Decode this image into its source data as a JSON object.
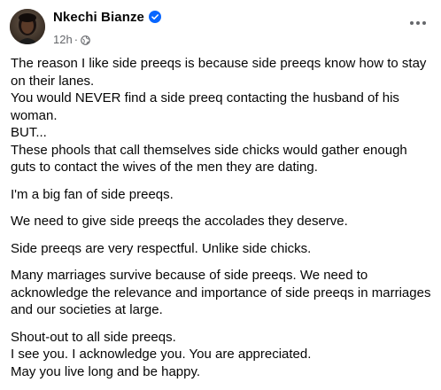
{
  "post": {
    "author": "Nkechi Bianze",
    "timestamp": "12h",
    "separator": "·",
    "verified": true,
    "audience_icon": "globe-icon",
    "more_icon": "more-options-icon",
    "paragraphs": [
      {
        "lines": [
          "The reason I like side preeqs is because side preeqs know how to stay on their lanes.",
          "You would NEVER find a side preeq contacting the husband of his woman.",
          "BUT...",
          "These phools that call themselves side chicks would gather enough guts to contact the wives of the men they are dating."
        ]
      },
      {
        "lines": [
          "I'm a big fan of side preeqs."
        ]
      },
      {
        "lines": [
          "We need to give side preeqs the accolades they deserve."
        ]
      },
      {
        "lines": [
          "Side preeqs are very respectful. Unlike side chicks."
        ]
      },
      {
        "lines": [
          "Many marriages survive because of side preeqs. We need to acknowledge the relevance and importance of side preeqs in marriages and our societies at large."
        ]
      },
      {
        "lines": [
          "Shout-out to all side preeqs.",
          "I see you. I acknowledge you. You are appreciated.",
          "May you live long and be happy."
        ]
      }
    ]
  },
  "colors": {
    "text": "#050505",
    "secondary_text": "#65676b",
    "verified_badge": "#0866ff",
    "background": "#ffffff"
  }
}
